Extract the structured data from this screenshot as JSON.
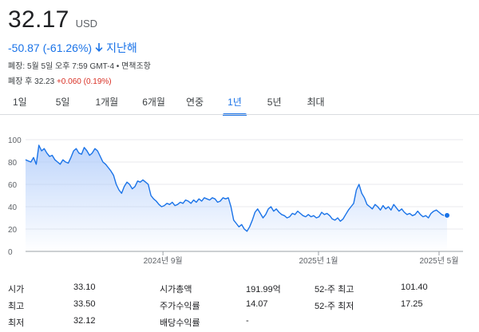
{
  "quote": {
    "price": "32.17",
    "currency": "USD",
    "change": "-50.87 (-61.26%)",
    "period": "지난해",
    "close_info": "폐장: 5월 5일 오후 7:59 GMT-4 • 면책조항",
    "after_hours_label": "폐장 후 32.23",
    "after_hours_change": "+0.060 (0.19%)"
  },
  "tabs": [
    {
      "label": "1일",
      "active": false
    },
    {
      "label": "5일",
      "active": false
    },
    {
      "label": "1개월",
      "active": false
    },
    {
      "label": "6개월",
      "active": false
    },
    {
      "label": "연중",
      "active": false
    },
    {
      "label": "1년",
      "active": true
    },
    {
      "label": "5년",
      "active": false
    },
    {
      "label": "최대",
      "active": false
    }
  ],
  "colors": {
    "line": "#1a73e8",
    "fill_top": "#a8c7fa",
    "negative": "#1a73e8",
    "positive_ah": "#d93025"
  },
  "chart_data": {
    "type": "area",
    "y_ticks": [
      "100",
      "80",
      "60",
      "40",
      "20",
      "0"
    ],
    "ylim": [
      0,
      100
    ],
    "x_ticks": [
      "2024년 9월",
      "2025년 1월",
      "2025년 5월"
    ],
    "x_tick_positions": [
      0.326,
      0.695,
      0.981
    ],
    "values": [
      82,
      81,
      80,
      84,
      78,
      95,
      90,
      92,
      88,
      85,
      86,
      82,
      80,
      78,
      82,
      80,
      79,
      84,
      90,
      92,
      88,
      87,
      93,
      90,
      86,
      88,
      92,
      90,
      85,
      80,
      78,
      75,
      72,
      68,
      60,
      55,
      52,
      58,
      62,
      60,
      56,
      58,
      63,
      62,
      64,
      62,
      60,
      50,
      47,
      45,
      42,
      40,
      41,
      43,
      42,
      44,
      41,
      42,
      44,
      43,
      46,
      45,
      43,
      46,
      44,
      47,
      45,
      48,
      47,
      46,
      48,
      47,
      44,
      45,
      48,
      47,
      48,
      40,
      28,
      25,
      22,
      24,
      20,
      18,
      22,
      28,
      35,
      38,
      34,
      30,
      33,
      38,
      40,
      36,
      38,
      35,
      33,
      32,
      30,
      31,
      34,
      33,
      36,
      34,
      32,
      31,
      33,
      31,
      32,
      30,
      31,
      35,
      33,
      34,
      32,
      29,
      28,
      30,
      27,
      29,
      33,
      37,
      40,
      43,
      55,
      60,
      52,
      48,
      42,
      40,
      38,
      42,
      40,
      37,
      41,
      38,
      40,
      37,
      42,
      39,
      36,
      38,
      35,
      33,
      34,
      32,
      33,
      36,
      33,
      31,
      32,
      30,
      34,
      36,
      37,
      35,
      33,
      32,
      32.2
    ]
  },
  "stats": [
    {
      "label": "시가",
      "value": "33.10"
    },
    {
      "label": "시가총액",
      "value": "191.99억"
    },
    {
      "label": "52-주 최고",
      "value": "101.40"
    },
    {
      "label": "최고",
      "value": "33.50"
    },
    {
      "label": "주가수익률",
      "value": "14.07"
    },
    {
      "label": "52-주 최저",
      "value": "17.25"
    },
    {
      "label": "최저",
      "value": "32.12"
    },
    {
      "label": "배당수익률",
      "value": "-"
    }
  ]
}
